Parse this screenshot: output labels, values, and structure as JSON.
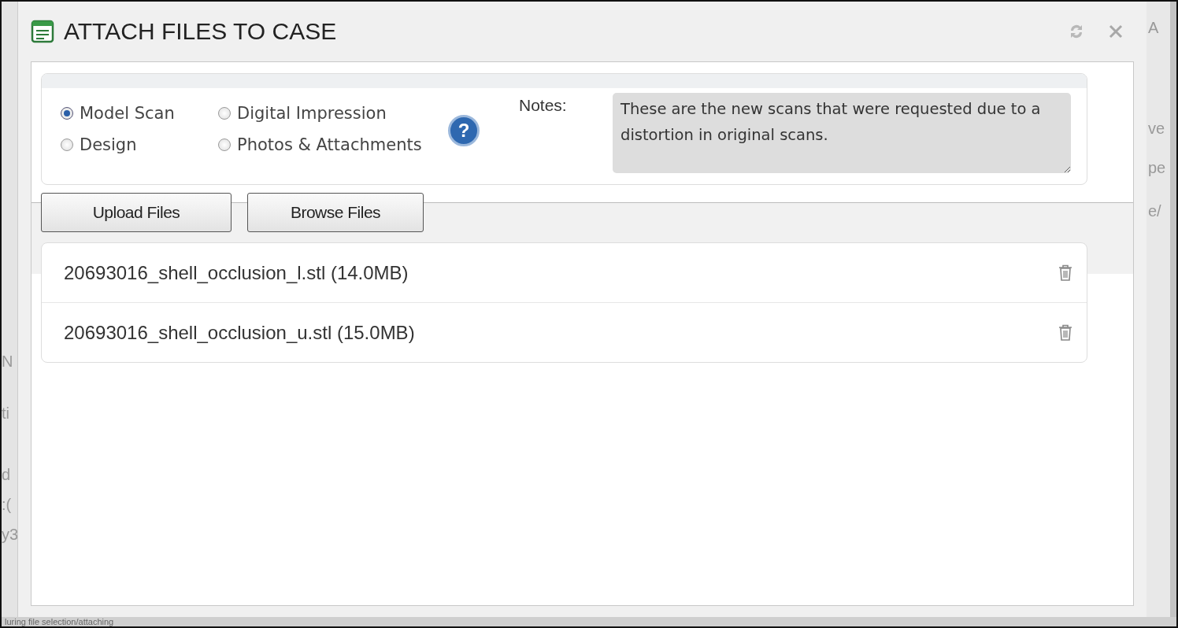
{
  "dialog": {
    "title": "ATTACH FILES TO CASE"
  },
  "file_types": [
    {
      "label": "Model Scan",
      "selected": true
    },
    {
      "label": "Digital Impression",
      "selected": false
    },
    {
      "label": "Design",
      "selected": false
    },
    {
      "label": "Photos & Attachments",
      "selected": false
    }
  ],
  "help": {
    "symbol": "?"
  },
  "notes": {
    "label": "Notes:",
    "value": "These are the new scans that were requested due to a distortion in original scans."
  },
  "buttons": [
    "Upload Files",
    "Browse Files"
  ],
  "files": [
    {
      "name": "20693016_shell_occlusion_l.stl (14.0MB)"
    },
    {
      "name": "20693016_shell_occlusion_u.stl (15.0MB)"
    }
  ],
  "background": {
    "left_fragments": [
      "N",
      "ti",
      "d",
      ":(",
      "y3"
    ],
    "right_fragments": [
      "A",
      "ve",
      "pe",
      "e/"
    ],
    "footer": "luring file selection/attaching"
  }
}
